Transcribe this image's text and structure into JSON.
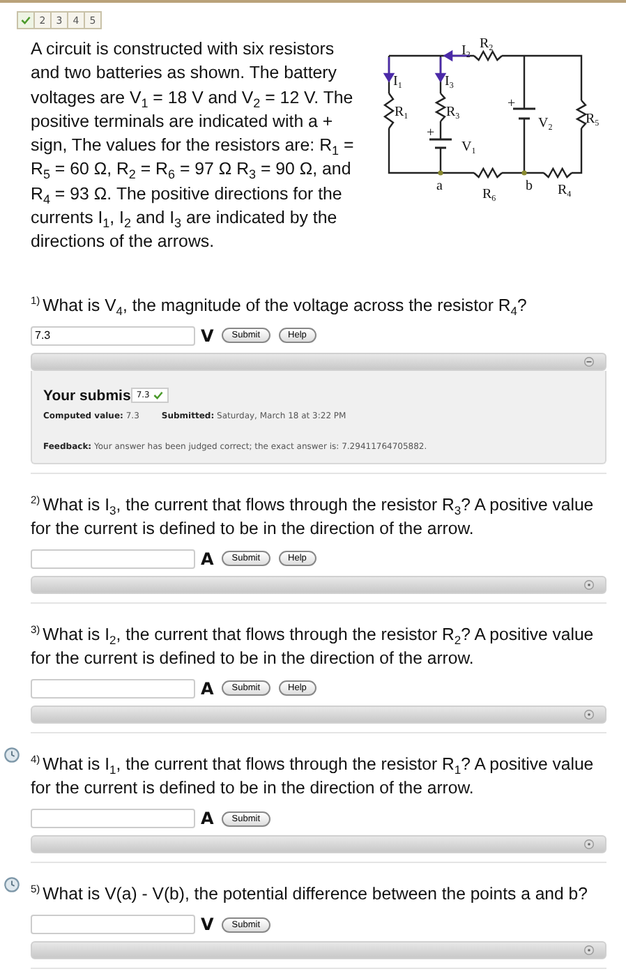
{
  "progress": [
    {
      "done": true
    },
    {
      "label": "2",
      "done": false
    },
    {
      "label": "3",
      "done": false
    },
    {
      "label": "4",
      "done": false
    },
    {
      "label": "5",
      "done": false
    }
  ],
  "intro": "A circuit is constructed with six resistors and two batteries as shown. The battery voltages are V$_{1}$ = 18 V and V$_{2}$ = 12 V. The positive terminals are indicated with a + sign, The values for the resistors are: R$_{1}$ = R$_{5}$ = 60 Ω, R$_{2}$ = R$_{6}$ = 97 Ω R$_{3}$ = 90 Ω, and R$_{4}$ = 93 Ω. The positive directions for the currents I$_{1}$, I$_{2}$ and I$_{3}$ are indicated by the directions of the arrows.",
  "circuit": {
    "labels": [
      {
        "text": "I",
        "sub": "2"
      },
      {
        "text": "R",
        "sub": "2"
      },
      {
        "text": "I",
        "sub": "1"
      },
      {
        "text": "I",
        "sub": "3"
      },
      {
        "text": "R",
        "sub": "1"
      },
      {
        "text": "R",
        "sub": "3"
      },
      {
        "text": "+"
      },
      {
        "text": "V",
        "sub": "1"
      },
      {
        "text": "+"
      },
      {
        "text": "V",
        "sub": "2"
      },
      {
        "text": "R",
        "sub": "5"
      },
      {
        "text": "a"
      },
      {
        "text": "R",
        "sub": "6"
      },
      {
        "text": "b"
      },
      {
        "text": "R",
        "sub": "4"
      }
    ]
  },
  "questions": [
    {
      "number": "1)",
      "text": "What is V$_{4}$, the magnitude of the voltage across the resistor R$_{4}$?",
      "value": "7.3",
      "unit": "V",
      "buttons": [
        "Submit",
        "Help"
      ],
      "pending": false,
      "expanded": true,
      "submission": {
        "title": "Your submis",
        "value": "7.3",
        "correct": true,
        "details": [
          {
            "label": "Computed value:",
            "text": "7.3"
          },
          {
            "label": "Submitted:",
            "text": "Saturday, March 18 at 3:22 PM"
          }
        ],
        "feedback": {
          "label": "Feedback:",
          "text": "Your answer has been judged correct; the exact answer is: 7.29411764705882."
        }
      }
    },
    {
      "number": "2)",
      "text": "What is I$_{3}$, the current that flows through the resistor R$_{3}$? A positive value for the current is defined to be in the direction of the arrow.",
      "unit": "A",
      "buttons": [
        "Submit",
        "Help"
      ],
      "pending": false,
      "expanded": false
    },
    {
      "number": "3)",
      "text": "What is I$_{2}$, the current that flows through the resistor R$_{2}$? A positive value for the current is defined to be in the direction of the arrow.",
      "unit": "A",
      "buttons": [
        "Submit",
        "Help"
      ],
      "pending": false,
      "expanded": false
    },
    {
      "number": "4)",
      "text": "What is I$_{1}$, the current that flows through the resistor R$_{1}$? A positive value for the current is defined to be in the direction of the arrow.",
      "unit": "A",
      "buttons": [
        "Submit"
      ],
      "pending": true,
      "expanded": false
    },
    {
      "number": "5)",
      "text": "What is V(a) - V(b), the potential difference between the points a and b?",
      "unit": "V",
      "buttons": [
        "Submit"
      ],
      "pending": true,
      "expanded": false
    }
  ]
}
